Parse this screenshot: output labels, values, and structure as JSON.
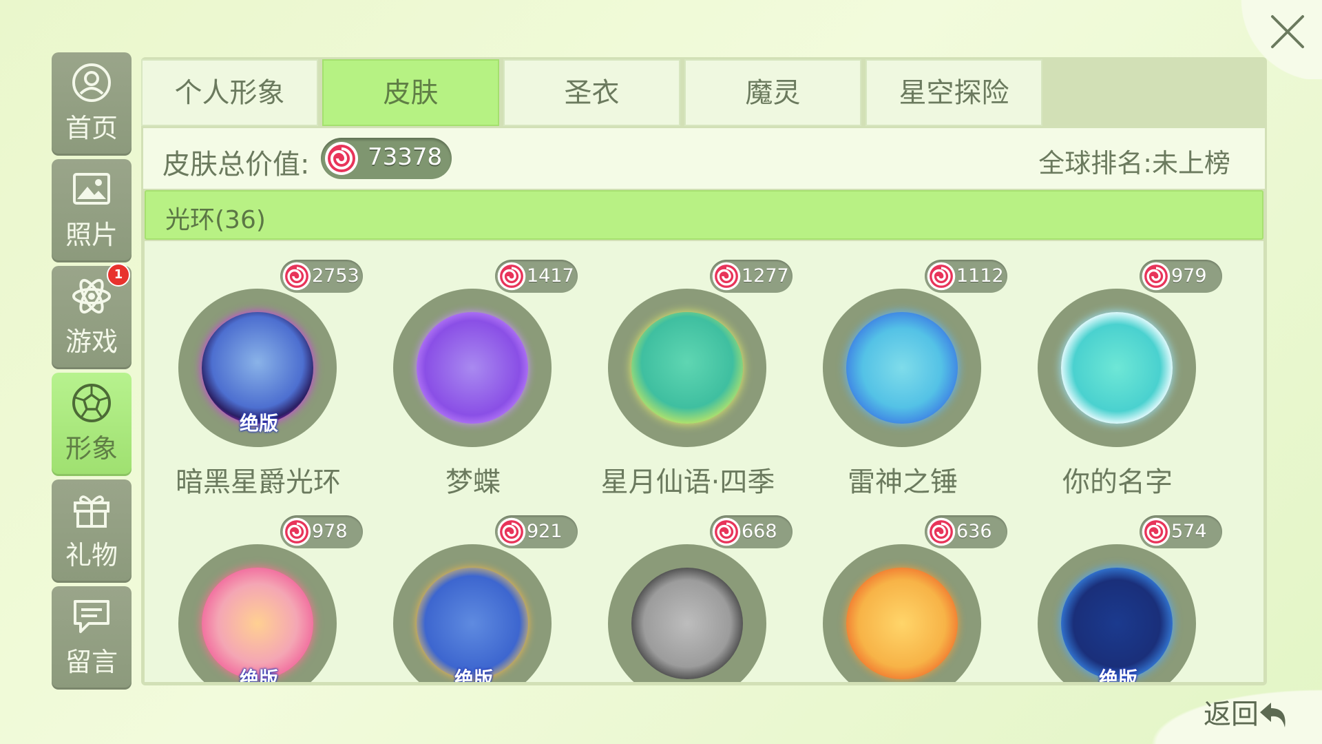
{
  "window": {
    "close_icon": "close-icon"
  },
  "sidebar": {
    "items": [
      {
        "label": "首页",
        "icon": "user-circle-icon",
        "active": false
      },
      {
        "label": "照片",
        "icon": "photo-icon",
        "active": false
      },
      {
        "label": "游戏",
        "icon": "atom-icon",
        "active": false,
        "badge": "1"
      },
      {
        "label": "形象",
        "icon": "soccer-ball-icon",
        "active": true
      },
      {
        "label": "礼物",
        "icon": "gift-icon",
        "active": false
      },
      {
        "label": "留言",
        "icon": "message-icon",
        "active": false
      }
    ]
  },
  "tabs": [
    {
      "label": "个人形象",
      "active": false
    },
    {
      "label": "皮肤",
      "active": true
    },
    {
      "label": "圣衣",
      "active": false
    },
    {
      "label": "魔灵",
      "active": false
    },
    {
      "label": "星空探险",
      "active": false
    }
  ],
  "summary": {
    "total_label": "皮肤总价值:",
    "total_value": "73378",
    "rank_text": "全球排名:未上榜"
  },
  "section": {
    "title": "光环(36)"
  },
  "items": [
    {
      "name": "暗黑星爵光环",
      "price": "2753",
      "limited": "绝版"
    },
    {
      "name": "梦蝶",
      "price": "1417"
    },
    {
      "name": "星月仙语·四季",
      "price": "1277"
    },
    {
      "name": "雷神之锤",
      "price": "1112"
    },
    {
      "name": "你的名字",
      "price": "979"
    },
    {
      "name": "",
      "price": "978",
      "limited": "绝版"
    },
    {
      "name": "",
      "price": "921",
      "limited": "绝版"
    },
    {
      "name": "",
      "price": "668"
    },
    {
      "name": "",
      "price": "636"
    },
    {
      "name": "",
      "price": "574",
      "limited": "绝版"
    }
  ],
  "footer": {
    "back_label": "返回",
    "back_icon": "return-arrow-icon"
  },
  "colors": {
    "active_green": "#b6f283",
    "sidebar_gray": "#8c9a7c",
    "badge_red": "#e8322d",
    "background": "#eaf7cc"
  }
}
